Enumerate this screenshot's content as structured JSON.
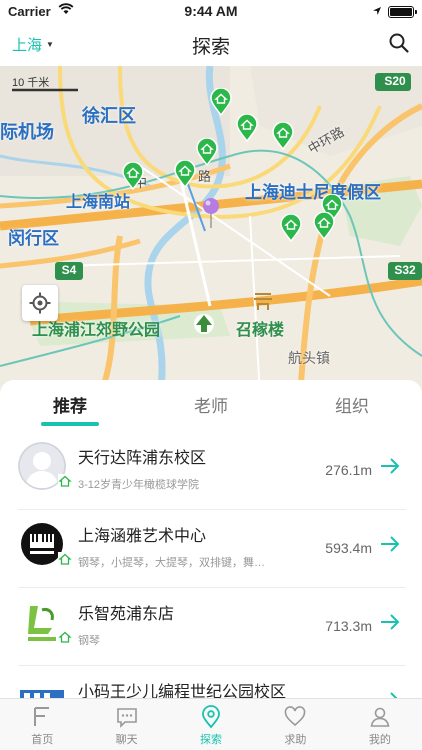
{
  "status_bar": {
    "carrier": "Carrier",
    "time": "9:44 AM",
    "battery_level": 1.0
  },
  "nav": {
    "city": "上海",
    "title": "探索"
  },
  "map": {
    "labels": {
      "xuhui": "徐汇区",
      "airport": "际机场",
      "south_station": "上海南站",
      "minhang": "闵行区",
      "disney": "上海迪士尼度假区",
      "pujiang_park": "上海浦江郊野公园",
      "zhaojialou": "召稼楼",
      "hangtou": "航头镇",
      "middle_ring": "中环路",
      "zhonghuan": "中",
      "lu": "路"
    },
    "scale_text": "10 千米",
    "shields": {
      "s20": "S20",
      "s4": "S4",
      "s32": "S32"
    }
  },
  "tabs": {
    "recommend": "推荐",
    "teacher": "老师",
    "organization": "组织"
  },
  "list": [
    {
      "title": "天行达阵浦东校区",
      "subtitle": "3-12岁青少年橄榄球学院",
      "distance": "276.1m"
    },
    {
      "title": "上海涵雅艺术中心",
      "subtitle": "钢琴，小提琴，大提琴，双排键，舞…",
      "distance": "593.4m"
    },
    {
      "title": "乐智苑浦东店",
      "subtitle": "钢琴",
      "distance": "713.3m"
    },
    {
      "title": "小码王少儿编程世纪公园校区",
      "subtitle": "",
      "distance": ""
    }
  ],
  "tabbar": [
    {
      "label": "首页",
      "icon": "home-f-icon"
    },
    {
      "label": "聊天",
      "icon": "chat-icon"
    },
    {
      "label": "探索",
      "icon": "location-pin-icon"
    },
    {
      "label": "求助",
      "icon": "heart-icon"
    },
    {
      "label": "我的",
      "icon": "user-icon"
    }
  ],
  "colors": {
    "accent": "#19c2ae",
    "marker_green": "#2bb74a",
    "user_pin": "#b57de0"
  }
}
